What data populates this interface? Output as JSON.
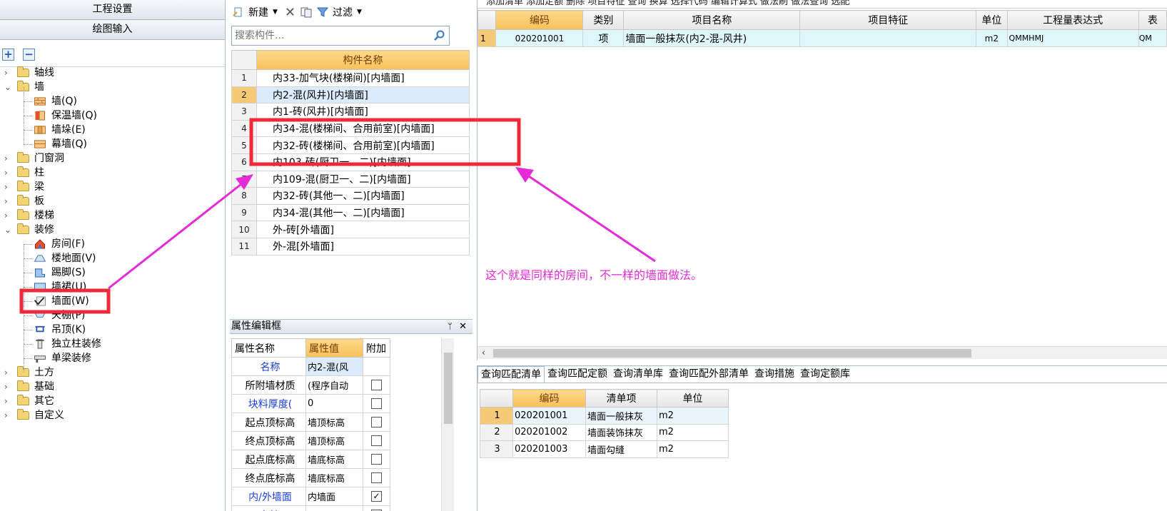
{
  "nav": {
    "header1": "工程设置",
    "header2": "绘图输入",
    "expand_label": "+",
    "collapse_label": "−",
    "tree": [
      {
        "label": "轴线",
        "level": 1,
        "chev": "›"
      },
      {
        "label": "墙",
        "level": 1,
        "chev": "⌄"
      },
      {
        "label": "墙(Q)",
        "level": 2
      },
      {
        "label": "保温墙(Q)",
        "level": 2
      },
      {
        "label": "墙垛(E)",
        "level": 2
      },
      {
        "label": "幕墙(Q)",
        "level": 2
      },
      {
        "label": "门窗洞",
        "level": 1,
        "chev": "›"
      },
      {
        "label": "柱",
        "level": 1,
        "chev": "›"
      },
      {
        "label": "梁",
        "level": 1,
        "chev": "›"
      },
      {
        "label": "板",
        "level": 1,
        "chev": "›"
      },
      {
        "label": "楼梯",
        "level": 1,
        "chev": "›"
      },
      {
        "label": "装修",
        "level": 1,
        "chev": "⌄"
      },
      {
        "label": "房间(F)",
        "level": 2
      },
      {
        "label": "楼地面(V)",
        "level": 2
      },
      {
        "label": "踢脚(S)",
        "level": 2
      },
      {
        "label": "墙裙(U)",
        "level": 2
      },
      {
        "label": "墙面(W)",
        "level": 2
      },
      {
        "label": "天棚(P)",
        "level": 2
      },
      {
        "label": "吊顶(K)",
        "level": 2
      },
      {
        "label": "独立柱装修",
        "level": 2
      },
      {
        "label": "单梁装修",
        "level": 2
      },
      {
        "label": "土方",
        "level": 1,
        "chev": "›"
      },
      {
        "label": "基础",
        "level": 1,
        "chev": "›"
      },
      {
        "label": "其它",
        "level": 1,
        "chev": "›"
      },
      {
        "label": "自定义",
        "level": 1,
        "chev": "›"
      }
    ]
  },
  "mid_toolbar": {
    "new_label": "新建",
    "filter_label": "过滤"
  },
  "search": {
    "placeholder": "搜索构件..."
  },
  "components": {
    "header": "构件名称",
    "rows": [
      {
        "num": "1",
        "name": "内33-加气块(楼梯间)[内墙面]"
      },
      {
        "num": "2",
        "name": "内2-混(风井)[内墙面]"
      },
      {
        "num": "3",
        "name": "内1-砖(风井)[内墙面]"
      },
      {
        "num": "4",
        "name": "内34-混(楼梯间、合用前室)[内墙面]"
      },
      {
        "num": "5",
        "name": "内32-砖(楼梯间、合用前室)[内墙面]"
      },
      {
        "num": "6",
        "name": "内103-砖(厨卫一、二)[内墙面]"
      },
      {
        "num": "7",
        "name": "内109-混(厨卫一、二)[内墙面]"
      },
      {
        "num": "8",
        "name": "内32-砖(其他一、二)[内墙面]"
      },
      {
        "num": "9",
        "name": "内34-混(其他一、二)[内墙面]"
      },
      {
        "num": "10",
        "name": "外-砖[外墙面]"
      },
      {
        "num": "11",
        "name": "外-混[外墙面]"
      }
    ]
  },
  "properties": {
    "title": "属性编辑框",
    "pin": "ᛘ",
    "close": "✕",
    "col_name": "属性名称",
    "col_value": "属性值",
    "col_extra": "附加",
    "rows": [
      {
        "name": "名称",
        "value": "内2-混(风",
        "blue": true,
        "check": "none"
      },
      {
        "name": "所附墙材质",
        "value": "(程序自动",
        "blue": false,
        "check": "off"
      },
      {
        "name": "块料厚度(",
        "value": "0",
        "blue": true,
        "check": "off"
      },
      {
        "name": "起点顶标高",
        "value": "墙顶标高",
        "blue": false,
        "check": "off"
      },
      {
        "name": "终点顶标高",
        "value": "墙顶标高",
        "blue": false,
        "check": "off"
      },
      {
        "name": "起点底标高",
        "value": "墙底标高",
        "blue": false,
        "check": "off"
      },
      {
        "name": "终点底标高",
        "value": "墙底标高",
        "blue": false,
        "check": "off"
      },
      {
        "name": "内/外墙面",
        "value": "内墙面",
        "blue": true,
        "check": "on"
      },
      {
        "name": "备注",
        "value": "",
        "blue": true,
        "check": "off"
      }
    ]
  },
  "right_toolbar": {
    "text": "添加清单  添加定额  删除  项目特征  查询  换算  选择代码  编辑计算式  做法刷  做法查询  选配"
  },
  "bill_list": {
    "headers": [
      "",
      "编码",
      "类别",
      "项目名称",
      "项目特征",
      "单位",
      "工程量表达式",
      "表"
    ],
    "row": {
      "num": "1",
      "code": "020201001",
      "type": "项",
      "name": "墙面一般抹灰(内2-混-风井)",
      "feature": "",
      "unit": "m2",
      "expr": "QMMHMJ",
      "extra": "QM"
    }
  },
  "tabs": [
    "查询匹配清单",
    "查询匹配定额",
    "查询清单库",
    "查询匹配外部清单",
    "查询措施",
    "查询定额库"
  ],
  "match": {
    "headers": [
      "",
      "编码",
      "清单项",
      "单位"
    ],
    "rows": [
      {
        "num": "1",
        "code": "020201001",
        "item": "墙面一般抹灰",
        "unit": "m2"
      },
      {
        "num": "2",
        "code": "020201002",
        "item": "墙面装饰抹灰",
        "unit": "m2"
      },
      {
        "num": "3",
        "code": "020201003",
        "item": "墙面勾缝",
        "unit": "m2"
      }
    ]
  },
  "annotation": {
    "text": "这个就是同样的房间，不一样的墙面做法。",
    "color": "#e62bd6",
    "box_color": "#ee2a3a"
  }
}
